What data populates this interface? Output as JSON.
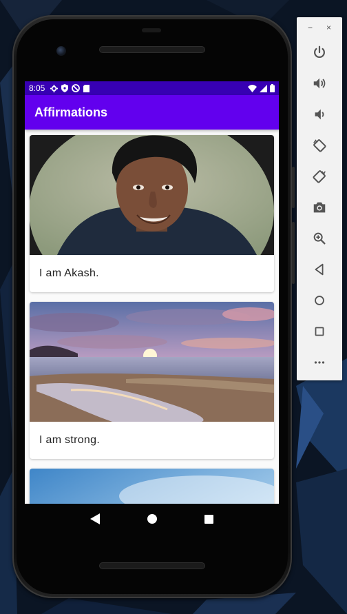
{
  "status_bar": {
    "time": "8:05"
  },
  "app_bar": {
    "title": "Affirmations"
  },
  "affirmations": [
    {
      "text": "I am Akash."
    },
    {
      "text": "I am strong."
    },
    {
      "text": ""
    }
  ],
  "toolbar": {
    "minimize": "−",
    "close": "×"
  },
  "colors": {
    "status_bar": "#3700b3",
    "app_bar": "#6200ee"
  }
}
